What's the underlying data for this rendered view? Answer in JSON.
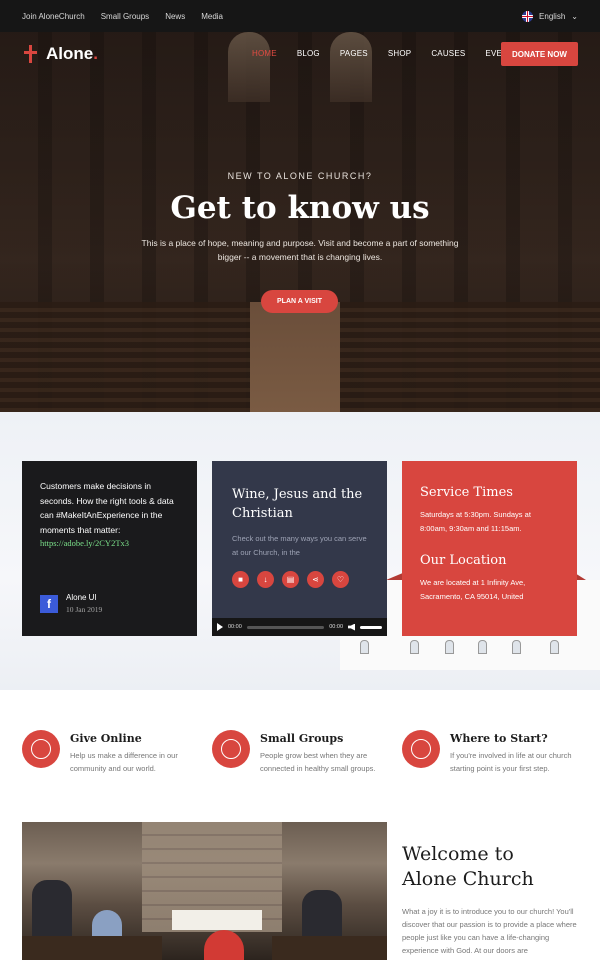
{
  "topbar": {
    "links": [
      "Join AloneChurch",
      "Small Groups",
      "News",
      "Media"
    ],
    "language": "English"
  },
  "header": {
    "logo": "Alone",
    "nav": [
      "HOME",
      "BLOG",
      "PAGES",
      "SHOP",
      "CAUSES",
      "EVENTS"
    ],
    "donate": "DONATE NOW"
  },
  "hero": {
    "eyebrow": "NEW TO ALONE CHURCH?",
    "title": "Get to know us",
    "subtitle": "This is a place of hope, meaning and purpose. Visit and become a part of something bigger -- a movement that is changing lives.",
    "cta": "PLAN A VISIT"
  },
  "cards": {
    "tweet": {
      "text": "Customers make decisions in seconds. How the right tools & data can #MakeItAnExperience in the moments that matter:",
      "link": "https://adobe.ly/2CY2Tx3",
      "author": "Alone UI",
      "date": "10 Jan 2019"
    },
    "audio": {
      "title": "Wine, Jesus and the Christian",
      "desc": "Check out the many ways you can serve at our Church, in the",
      "time_current": "00:00",
      "time_total": "00:00"
    },
    "info": {
      "service_title": "Service Times",
      "service_text": "Saturdays at 5:30pm. Sundays at 8:00am, 9:30am and 11:15am.",
      "location_title": "Our Location",
      "location_text": "We are located at 1 Infinity Ave, Sacramento, CA 95014, United"
    }
  },
  "features": [
    {
      "title": "Give Online",
      "desc": "Help us make a difference in our community and our world."
    },
    {
      "title": "Small Groups",
      "desc": "People grow best when they are connected in healthy small groups."
    },
    {
      "title": "Where to Start?",
      "desc": "If you're involved in life at our church starting point is your first step."
    }
  ],
  "welcome": {
    "title_line1": "Welcome to",
    "title_line2": "Alone Church",
    "text": "What a joy it is to introduce you to our church! You'll discover that our passion is to provide a place where people just like you can have a life-changing experience with God. At our doors are"
  },
  "colors": {
    "accent": "#d8463f",
    "dark_card": "#1a1a1c",
    "navy_card": "#33384a"
  }
}
